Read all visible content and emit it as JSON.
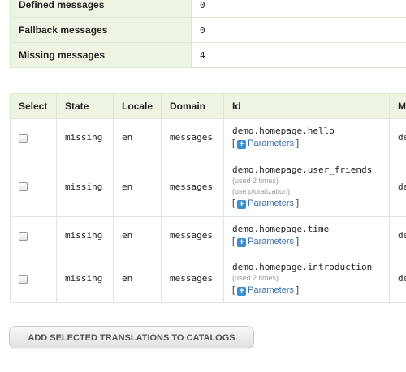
{
  "summary": {
    "rows": [
      {
        "label": "Defined messages",
        "value": "0"
      },
      {
        "label": "Fallback messages",
        "value": "0"
      },
      {
        "label": "Missing messages",
        "value": "4"
      }
    ]
  },
  "messages": {
    "headers": [
      "Select",
      "State",
      "Locale",
      "Domain",
      "Id",
      "Me"
    ],
    "rows": [
      {
        "state": "missing",
        "locale": "en",
        "domain": "messages",
        "id": "demo.homepage.hello",
        "used": "",
        "pluralization": "",
        "message": "de"
      },
      {
        "state": "missing",
        "locale": "en",
        "domain": "messages",
        "id": "demo.homepage.user_friends",
        "used": "(used 2 times)",
        "pluralization": "(use pluralization)",
        "message": "de"
      },
      {
        "state": "missing",
        "locale": "en",
        "domain": "messages",
        "id": "demo.homepage.time",
        "used": "",
        "pluralization": "",
        "message": "de"
      },
      {
        "state": "missing",
        "locale": "en",
        "domain": "messages",
        "id": "demo.homepage.introduction",
        "used": "(used 2 times)",
        "pluralization": "",
        "message": "de"
      }
    ],
    "params_open": "[",
    "params_label": "Parameters",
    "params_close": "]",
    "plus_glyph": "+"
  },
  "actions": {
    "add_button_label": "ADD SELECTED TRANSLATIONS TO CATALOGS"
  },
  "colors": {
    "header_bg": "#eef4e3",
    "link": "#3b6fa8",
    "plus_icon": "#3a8fd0"
  }
}
